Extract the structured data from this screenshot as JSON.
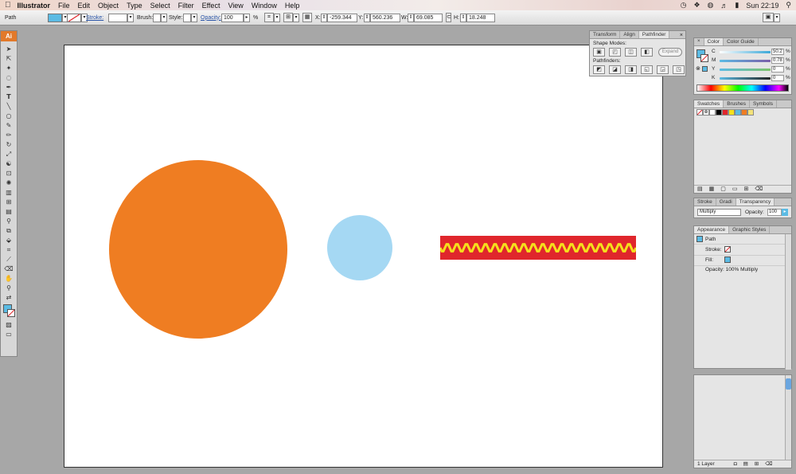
{
  "menubar": {
    "apple": "",
    "app": "Illustrator",
    "items": [
      "File",
      "Edit",
      "Object",
      "Type",
      "Select",
      "Filter",
      "Effect",
      "View",
      "Window",
      "Help"
    ],
    "clock": "Sun 22:19"
  },
  "control": {
    "selection": "Path",
    "stroke_label": "Stroke:",
    "brush_label": "Brush:",
    "style_label": "Style:",
    "opacity_label": "Opacity:",
    "opacity_value": "100",
    "percent": "%",
    "x_label": "X:",
    "x_value": "-259.344 px",
    "y_label": "Y:",
    "y_value": "560.236 px",
    "w_label": "W:",
    "w_value": "69.085 px",
    "h_label": "H:",
    "h_value": "18.248 px",
    "fill_color": "#5bbbe4"
  },
  "toolbox": {
    "logo": "Ai",
    "tools": [
      "selection",
      "direct-selection",
      "magic-wand",
      "lasso",
      "pen",
      "type",
      "line",
      "rectangle",
      "paintbrush",
      "pencil",
      "rotate",
      "scale",
      "warp",
      "free-transform",
      "symbol-sprayer",
      "graph",
      "mesh",
      "gradient",
      "eyedropper",
      "blend",
      "live-paint",
      "crop",
      "slice",
      "eraser",
      "hand",
      "zoom"
    ]
  },
  "canvas": {
    "artboard_color": "#ffffff",
    "orange_color": "#ef7d22",
    "blue_color": "#a5d8f3",
    "wave_bg": "#e0262c",
    "wave_color": "#f5e01c"
  },
  "pathfinder": {
    "tabs": [
      "Transform",
      "Align",
      "Pathfinder"
    ],
    "shape_modes_label": "Shape Modes:",
    "expand_label": "Expand",
    "pathfinders_label": "Pathfinders:"
  },
  "color_panel": {
    "tabs": [
      "Color",
      "Color Guide"
    ],
    "channels": [
      {
        "name": "C",
        "value": "50.2",
        "color": "#3aa8d8"
      },
      {
        "name": "M",
        "value": "0.78",
        "color": "#d63a8c"
      },
      {
        "name": "Y",
        "value": "0",
        "color": "#e0d21e"
      },
      {
        "name": "K",
        "value": "0",
        "color": "#222222"
      }
    ],
    "percent": "%"
  },
  "swatches_panel": {
    "tabs": [
      "Swatches",
      "Brushes",
      "Symbols"
    ],
    "swatch_colors": [
      "#ffffff",
      "#000000",
      "#e0262c",
      "#f5e01c",
      "#5bbbe4",
      "#ef7d22",
      "#f3e27a"
    ]
  },
  "transparency_panel": {
    "tabs": [
      "Stroke",
      "Gradi",
      "Transparency"
    ],
    "blend_mode": "Multiply",
    "opacity_label": "Opacity:",
    "opacity_value": "100"
  },
  "appearance_panel": {
    "tabs": [
      "Appearance",
      "Graphic Styles"
    ],
    "title": "Path",
    "stroke_label": "Stroke:",
    "fill_label": "Fill:",
    "opacity_text": "Opacity: 100% Multiply"
  },
  "layers_panel": {
    "count_label": "1 Layer"
  }
}
